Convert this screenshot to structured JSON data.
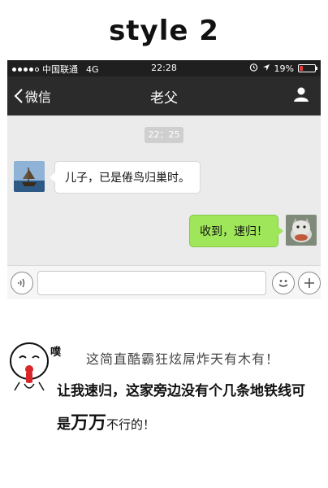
{
  "heading": "style 2",
  "status_bar": {
    "carrier": "中国联通",
    "network": "4G",
    "time": "22:28",
    "battery": "19%",
    "battery_level": 0.19,
    "battery_color": "#e23b3b"
  },
  "nav": {
    "back_label": "微信",
    "title": "老父"
  },
  "chat": {
    "timestamp": "22：25",
    "messages": [
      {
        "from": "father",
        "text": "儿子，已是倦鸟归巢时。"
      },
      {
        "from": "me",
        "text": "收到，速归！"
      }
    ],
    "sent_bubble_color": "#9fe65a"
  },
  "input_bar": {
    "placeholder": ""
  },
  "caption": {
    "exclamation": "噗",
    "line1": "这简直酷霸狂炫屌炸天有木有！",
    "line2": "让我速归，这家旁边没有个几条地铁线可",
    "line3_prefix": "是",
    "line3_big": "万万",
    "line3_suffix": "不行的！"
  }
}
